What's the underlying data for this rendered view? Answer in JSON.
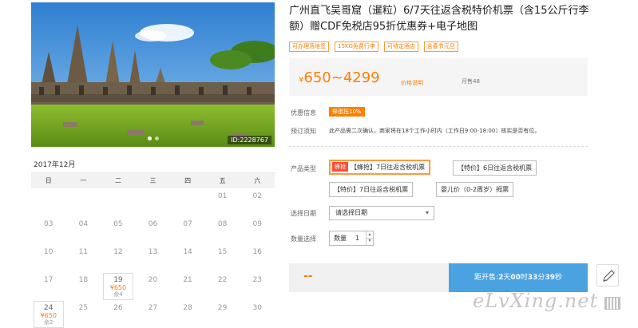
{
  "photo": {
    "id_label": "ID:2228767"
  },
  "calendar": {
    "month": "2017年12月",
    "weekdays": [
      "日",
      "一",
      "二",
      "三",
      "四",
      "五",
      "六"
    ],
    "days": [
      {
        "d": ""
      },
      {
        "d": ""
      },
      {
        "d": ""
      },
      {
        "d": ""
      },
      {
        "d": ""
      },
      {
        "d": "01"
      },
      {
        "d": "02"
      },
      {
        "d": "03"
      },
      {
        "d": "04"
      },
      {
        "d": "05"
      },
      {
        "d": "06"
      },
      {
        "d": "07"
      },
      {
        "d": "08"
      },
      {
        "d": "09"
      },
      {
        "d": "10"
      },
      {
        "d": "11"
      },
      {
        "d": "12"
      },
      {
        "d": "13"
      },
      {
        "d": "14"
      },
      {
        "d": "15"
      },
      {
        "d": "16"
      },
      {
        "d": "17"
      },
      {
        "d": "18"
      },
      {
        "d": "19",
        "price": "¥650",
        "stock": "余4"
      },
      {
        "d": "20"
      },
      {
        "d": "21"
      },
      {
        "d": "22"
      },
      {
        "d": "23"
      },
      {
        "d": "24",
        "price": "¥650",
        "stock": "余2"
      },
      {
        "d": "25"
      },
      {
        "d": "26"
      },
      {
        "d": "27"
      },
      {
        "d": "28"
      },
      {
        "d": "29"
      },
      {
        "d": "30"
      }
    ]
  },
  "product": {
    "title": "广州直飞吴哥窟（暹粒）6/7天往返含税特价机票（含15公斤行李额）赠CDF免税店95折优惠券+电子地图",
    "tags": [
      "可办理落地签",
      "15KG免费行李",
      "可待定酒店",
      "含春节元旦"
    ],
    "price_currency": "¥",
    "price_range": "650~4299",
    "price_note": "价格说明",
    "sold": "月售48"
  },
  "promo": {
    "label": "优惠信息",
    "badge": "蜂蛋抵10%"
  },
  "notice": {
    "label": "预订须知",
    "text": "此产品需二次确认，商家将在18个工作小时内（工作日9:00-18:00）核实是否有位。"
  },
  "options": {
    "label": "产品类型",
    "flash_badge": "蜂抢",
    "items": [
      "【蜂抢】7日往返含税机票",
      "【特价】6日往返含税机票",
      "【特价】7日往返含税机票",
      "婴儿价（0-2周岁）拇票"
    ]
  },
  "date_select": {
    "label": "选择日期",
    "placeholder": "请选择日期",
    "caret": "▾"
  },
  "quantity": {
    "label": "数量选择",
    "field_label": "数量",
    "value": "1",
    "up": "▴",
    "down": "▾"
  },
  "buy_bar": {
    "dash": "--",
    "prefix": "距开售:",
    "days": "2",
    "days_unit": "天",
    "hours": "00",
    "hours_unit": "时",
    "minutes": "33",
    "minutes_unit": "分",
    "seconds": "39",
    "seconds_unit": "秒"
  },
  "watermark": "eLvXing.net"
}
